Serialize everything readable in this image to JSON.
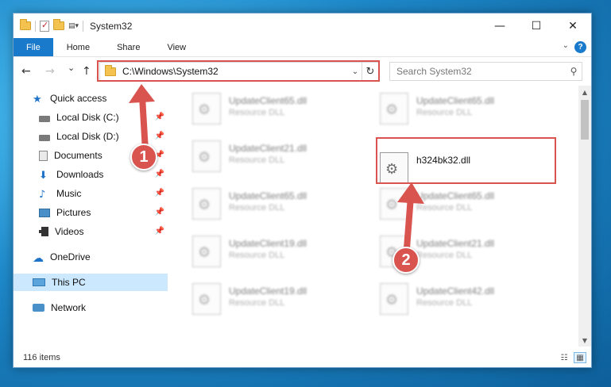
{
  "window": {
    "title": "System32",
    "minimize": "—",
    "maximize": "☐",
    "close": "✕"
  },
  "ribbon": {
    "tabs": [
      "File",
      "Home",
      "Share",
      "View"
    ],
    "help": "?"
  },
  "nav": {
    "back": "←",
    "forward": "→",
    "recent": "⌄",
    "up": "↑",
    "address": "C:\\Windows\\System32",
    "search_placeholder": "Search System32"
  },
  "sidebar": {
    "items": [
      {
        "label": "Quick access",
        "icon": "star-icon"
      },
      {
        "label": "Local Disk (C:)",
        "icon": "drive-icon",
        "pinned": true
      },
      {
        "label": "Local Disk (D:)",
        "icon": "drive-icon",
        "pinned": true
      },
      {
        "label": "Documents",
        "icon": "documents-icon",
        "pinned": true
      },
      {
        "label": "Downloads",
        "icon": "downloads-icon",
        "pinned": true
      },
      {
        "label": "Music",
        "icon": "music-icon",
        "pinned": true
      },
      {
        "label": "Pictures",
        "icon": "pictures-icon",
        "pinned": true
      },
      {
        "label": "Videos",
        "icon": "videos-icon",
        "pinned": true
      },
      {
        "label": "OneDrive",
        "icon": "onedrive-icon"
      },
      {
        "label": "This PC",
        "icon": "this-pc-icon",
        "selected": true
      },
      {
        "label": "Network",
        "icon": "network-icon"
      }
    ]
  },
  "files": [
    {
      "name": "UpdateClient65.dll",
      "type": "Resource DLL",
      "blurred": true
    },
    {
      "name": "UpdateClient65.dll",
      "type": "Resource DLL",
      "blurred": true
    },
    {
      "name": "UpdateClient21.dll",
      "type": "Resource DLL",
      "blurred": true
    },
    {
      "name": "h324bk32.dll",
      "type": "",
      "blurred": false
    },
    {
      "name": "UpdateClient65.dll",
      "type": "Resource DLL",
      "blurred": true
    },
    {
      "name": "UpdateClient65.dll",
      "type": "Resource DLL",
      "blurred": true
    },
    {
      "name": "UpdateClient19.dll",
      "type": "Resource DLL",
      "blurred": true
    },
    {
      "name": "UpdateClient21.dll",
      "type": "Resource DLL",
      "blurred": true
    },
    {
      "name": "UpdateClient19.dll",
      "type": "Resource DLL",
      "blurred": true
    },
    {
      "name": "UpdateClient42.dll",
      "type": "Resource DLL",
      "blurred": true
    }
  ],
  "status": {
    "item_count": "116 items"
  },
  "callouts": {
    "one": "1",
    "two": "2"
  },
  "colors": {
    "accent": "#1979ca",
    "highlight": "#d9534f",
    "selected": "#cce8ff"
  }
}
